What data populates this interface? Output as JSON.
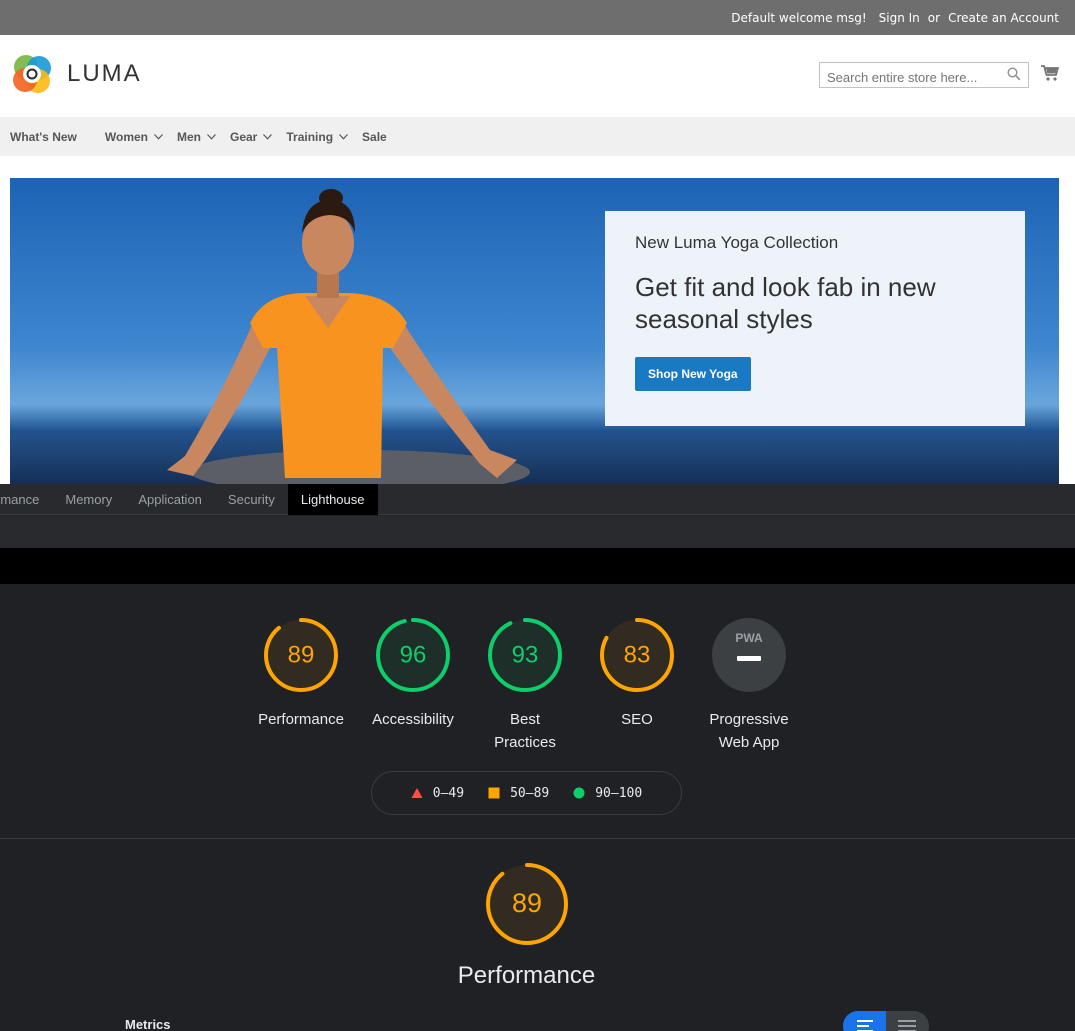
{
  "store": {
    "topbar": {
      "welcome": "Default welcome msg!",
      "sign_in": "Sign In",
      "or": "or",
      "create_account": "Create an Account"
    },
    "logo": {
      "text": "LUMA",
      "colors": [
        "#f26322",
        "#fdb913",
        "#7cb84a",
        "#1a9ad6"
      ]
    },
    "search": {
      "placeholder": "Search entire store here..."
    },
    "nav": [
      "What's New",
      "Women",
      "Men",
      "Gear",
      "Training",
      "Sale"
    ],
    "hero": {
      "subtitle": "New Luma Yoga Collection",
      "title": "Get fit and look fab in new seasonal styles",
      "button": "Shop New Yoga"
    },
    "accent": "#1979c3"
  },
  "devtools": {
    "tabs": [
      "rmance",
      "Memory",
      "Application",
      "Security",
      "Lighthouse"
    ],
    "active_tab": "Lighthouse",
    "scores": [
      {
        "label": "Performance",
        "score": "89",
        "value": 89,
        "status": "average"
      },
      {
        "label": "Accessibility",
        "score": "96",
        "value": 96,
        "status": "pass"
      },
      {
        "label": "Best Practices",
        "score": "93",
        "value": 93,
        "status": "pass"
      },
      {
        "label": "SEO",
        "score": "83",
        "value": 83,
        "status": "average"
      },
      {
        "label": "Progressive Web App",
        "score": "PWA",
        "status": "na"
      }
    ],
    "legend": [
      {
        "range": "0–49",
        "shape": "triangle",
        "color": "#ff4e42"
      },
      {
        "range": "50–89",
        "shape": "square",
        "color": "#ffa400"
      },
      {
        "range": "90–100",
        "shape": "circle",
        "color": "#0cce6b"
      }
    ],
    "focus": {
      "score": "89",
      "value": 89,
      "title": "Performance"
    },
    "metrics_label": "Metrics",
    "colors": {
      "pass": "#0cce6b",
      "average": "#ffa400",
      "fail": "#ff4e42"
    }
  }
}
